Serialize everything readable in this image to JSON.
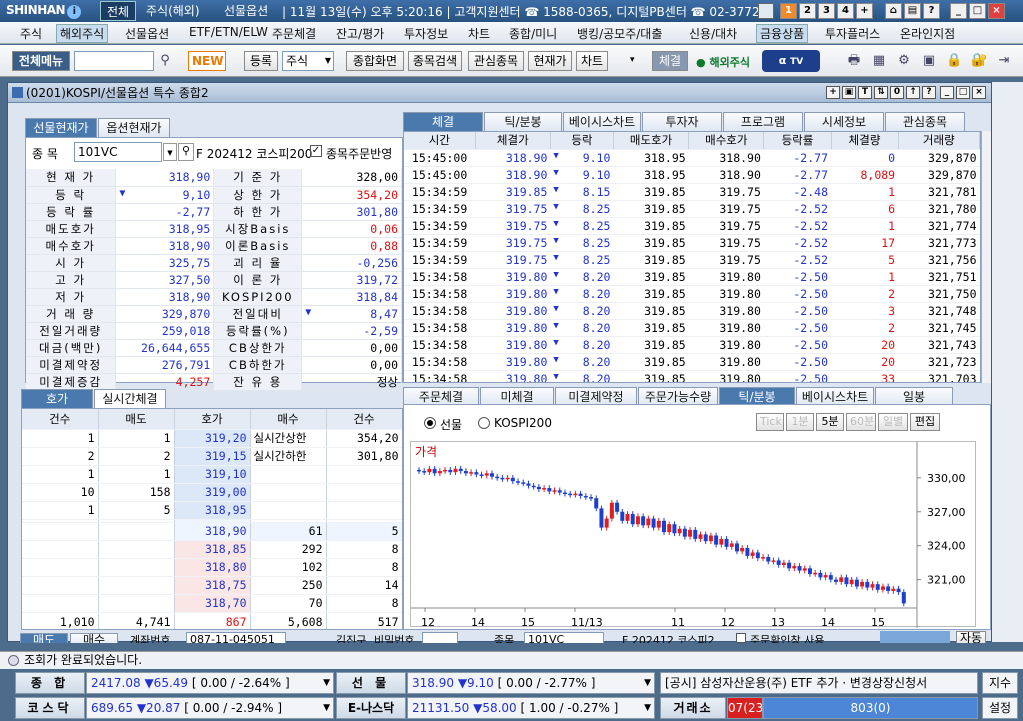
{
  "app": {
    "logo": "SHINHAN",
    "logo_badge": "i",
    "top_tabs": [
      "전체",
      "주식(해외)",
      "선물옵션"
    ],
    "ticker": "| 11월 13일(수) 오후 5:20:16 | 고객지원센터 ☎ 1588-0365, 디지털PB센터 ☎ 02-3772-",
    "top_buttons": [
      "1",
      "2",
      "3",
      "4",
      "+"
    ]
  },
  "menu": [
    "주식",
    "해외주식",
    "선물옵션",
    "ETF/ETN/ELW",
    "주문체결",
    "잔고/평가",
    "투자정보",
    "차트",
    "종합/미니",
    "뱅킹/공모주/대출",
    "신용/대차",
    "금융상품",
    "투자플러스",
    "온라인지점"
  ],
  "toolbar": {
    "all_menu": "전체메뉴",
    "new": "NEW",
    "register": "등록",
    "stock_select": "주식",
    "btns": [
      "종합화면",
      "종목검색",
      "관심종목",
      "현재가",
      "차트"
    ],
    "fill": "체결",
    "overseas": "해외주식",
    "tv": "TV"
  },
  "window": {
    "title": "(0201)KOSPI/선물옵션 특수 종합2"
  },
  "left": {
    "tabs": [
      "선물현재가",
      "옵션현재가"
    ],
    "code_label": "종  목",
    "code": "101VC",
    "desc": "F 202412 코스피200",
    "reflect_label": "종목주문반영",
    "rows": [
      [
        "현 재 가",
        "318,90",
        "기 준 가",
        "328,00"
      ],
      [
        "등    락",
        "9,10",
        "상 한 가",
        "354,20"
      ],
      [
        "등 락 률",
        "-2,77",
        "하 한 가",
        "301,80"
      ],
      [
        "매도호가",
        "318,95",
        "시장Basis",
        "0,06"
      ],
      [
        "매수호가",
        "318,90",
        "이론Basis",
        "0,88"
      ],
      [
        "시    가",
        "325,75",
        "괴 리 율",
        "-0,256"
      ],
      [
        "고    가",
        "327,50",
        "이 론 가",
        "319,72"
      ],
      [
        "저    가",
        "318,90",
        "KOSPI200",
        "318,84"
      ],
      [
        "거 래 량",
        "329,870",
        "전일대비",
        "8,47"
      ],
      [
        "전일거래량",
        "259,018",
        "등락률(%)",
        "-2,59"
      ],
      [
        "대금(백만)",
        "26,644,655",
        "CB상한가",
        "0,00"
      ],
      [
        "미결제약정",
        "276,791",
        "CB하한가",
        "0,00"
      ],
      [
        "미결제증감",
        "4,257",
        "잔 유 용",
        "정상"
      ]
    ]
  },
  "orderbook": {
    "tabs": [
      "호가",
      "실시간체결"
    ],
    "headers": [
      "건수",
      "매도",
      "호가",
      "매수",
      "건수"
    ],
    "asks": [
      [
        "1",
        "1",
        "319,20"
      ],
      [
        "2",
        "2",
        "319,15"
      ],
      [
        "1",
        "1",
        "319,10"
      ],
      [
        "10",
        "158",
        "319,00"
      ],
      [
        "1",
        "5",
        "318,95"
      ]
    ],
    "bids": [
      [
        "318,90",
        "61",
        "5"
      ],
      [
        "318,85",
        "292",
        "8"
      ],
      [
        "318,80",
        "102",
        "8"
      ],
      [
        "318,75",
        "250",
        "14"
      ],
      [
        "318,70",
        "70",
        "8"
      ]
    ],
    "limit_up_label": "실시간상한",
    "limit_up": "354,20",
    "limit_down_label": "실시간하한",
    "limit_down": "301,80",
    "totals": [
      "1,010",
      "4,741",
      "867",
      "5,608",
      "517"
    ]
  },
  "trades": {
    "tabs": [
      "체결",
      "틱/분봉",
      "베이시스차트",
      "투자자",
      "프로그램",
      "시세정보",
      "관심종목"
    ],
    "headers": [
      "시간",
      "체결가",
      "등락",
      "매도호가",
      "매수호가",
      "등락률",
      "체결량",
      "거래량"
    ],
    "rows": [
      [
        "15:45:00",
        "318.90",
        "9.10",
        "318.95",
        "318.90",
        "-2.77",
        "0",
        "329,870"
      ],
      [
        "15:45:00",
        "318.90",
        "9.10",
        "318.95",
        "318.90",
        "-2.77",
        "8,089",
        "329,870"
      ],
      [
        "15:34:59",
        "319.85",
        "8.15",
        "319.85",
        "319.75",
        "-2.48",
        "1",
        "321,781"
      ],
      [
        "15:34:59",
        "319.75",
        "8.25",
        "319.85",
        "319.75",
        "-2.52",
        "6",
        "321,780"
      ],
      [
        "15:34:59",
        "319.75",
        "8.25",
        "319.85",
        "319.75",
        "-2.52",
        "1",
        "321,774"
      ],
      [
        "15:34:59",
        "319.75",
        "8.25",
        "319.85",
        "319.75",
        "-2.52",
        "17",
        "321,773"
      ],
      [
        "15:34:59",
        "319.75",
        "8.25",
        "319.85",
        "319.75",
        "-2.52",
        "5",
        "321,756"
      ],
      [
        "15:34:58",
        "319.80",
        "8.20",
        "319.85",
        "319.80",
        "-2.50",
        "1",
        "321,751"
      ],
      [
        "15:34:58",
        "319.80",
        "8.20",
        "319.85",
        "319.80",
        "-2.50",
        "2",
        "321,750"
      ],
      [
        "15:34:58",
        "319.80",
        "8.20",
        "319.85",
        "319.80",
        "-2.50",
        "3",
        "321,748"
      ],
      [
        "15:34:58",
        "319.80",
        "8.20",
        "319.85",
        "319.80",
        "-2.50",
        "2",
        "321,745"
      ],
      [
        "15:34:58",
        "319.80",
        "8.20",
        "319.85",
        "319.80",
        "-2.50",
        "20",
        "321,743"
      ],
      [
        "15:34:58",
        "319.80",
        "8.20",
        "319.85",
        "319.80",
        "-2.50",
        "20",
        "321,723"
      ],
      [
        "15:34:58",
        "319.80",
        "8.20",
        "319.85",
        "319.80",
        "-2.50",
        "33",
        "321,703"
      ]
    ]
  },
  "chartpanel": {
    "tabs": [
      "주문체결",
      "미체결",
      "미결제약정",
      "주문가능수량",
      "틱/분봉",
      "베이시스차트",
      "일봉"
    ],
    "radio1": "선물",
    "radio2": "KOSPI200",
    "periods": [
      "Tick",
      "1분",
      "5분",
      "60분",
      "일별",
      "편집"
    ],
    "price_label": "가격",
    "y_ticks": [
      "330,00",
      "327,00",
      "324,00",
      "321,00"
    ],
    "x_ticks": [
      "12",
      "14",
      "15",
      "11/13",
      "11",
      "12",
      "13",
      "14",
      "15"
    ]
  },
  "order": {
    "tabs": [
      "매도",
      "매수"
    ],
    "acct_label": "계좌번호",
    "acct": "087-11-045051",
    "acct_name": "김진구",
    "pw_label": "비밀번호",
    "code_label": "종목",
    "code": "101VC",
    "desc": "F 202412 코스피2",
    "confirm": "주문확인창 사용",
    "btn": "자동"
  },
  "status": "조회가 완료되었습니다.",
  "market": {
    "kospi_label": "종 합",
    "kospi": "2417.08",
    "kospi_chg": "▼65.49",
    "kospi_pct": "[ 0.00 / -2.64% ]",
    "fut_label": "선 물",
    "fut": "318.90",
    "fut_chg": "▼9.10",
    "fut_pct": "[ 0.00 / -2.77% ]",
    "news": "[공시] 삼성자산운용(주) ETF 추가 · 변경상장신청서",
    "news_btn": "지수",
    "kosdaq_label": "코스닥",
    "kosdaq": "689.65",
    "kosdaq_chg": "▼20.87",
    "kosdaq_pct": "[ 0.00 / -2.94% ]",
    "enasdaq_label": "E-나스닥",
    "enasdaq": "21131.50",
    "enasdaq_chg": "▼58.00",
    "enasdaq_pct": "[ 1.00 / -0.27% ]",
    "exch_label": "거래소",
    "adv": "07(23",
    "vol": "803(0)",
    "settings": "설정"
  },
  "chart_data": {
    "type": "candlestick",
    "y_ticks": [
      330,
      327,
      324,
      321
    ],
    "ylim": [
      319.2,
      331.4
    ],
    "closes": [
      330.6,
      330.5,
      330.8,
      330.4,
      330.6,
      330.7,
      330.5,
      330.8,
      330.6,
      330.4,
      330.5,
      330.3,
      330.2,
      330.4,
      330.1,
      330.0,
      329.9,
      330.0,
      329.7,
      329.6,
      329.5,
      329.3,
      329.2,
      329.0,
      329.1,
      328.8,
      328.9,
      328.7,
      328.6,
      328.5,
      328.6,
      328.4,
      328.3,
      328.2,
      327.3,
      325.6,
      326.4,
      327.8,
      327.0,
      326.2,
      326.8,
      325.9,
      326.6,
      325.8,
      326.4,
      325.6,
      326.2,
      325.2,
      325.9,
      325.1,
      325.5,
      324.8,
      325.4,
      324.6,
      325.0,
      324.4,
      324.9,
      324.1,
      324.6,
      323.9,
      324.2,
      323.5,
      323.8,
      323.1,
      323.4,
      322.9,
      323.0,
      322.6,
      322.7,
      322.3,
      322.5,
      322.0,
      322.2,
      321.8,
      322.0,
      321.5,
      321.6,
      321.2,
      321.4,
      321.0,
      320.8,
      321.2,
      320.6,
      321.0,
      320.4,
      320.8,
      320.3,
      320.6,
      320.1,
      320.4,
      320.0,
      320.2,
      319.9,
      318.9
    ]
  }
}
